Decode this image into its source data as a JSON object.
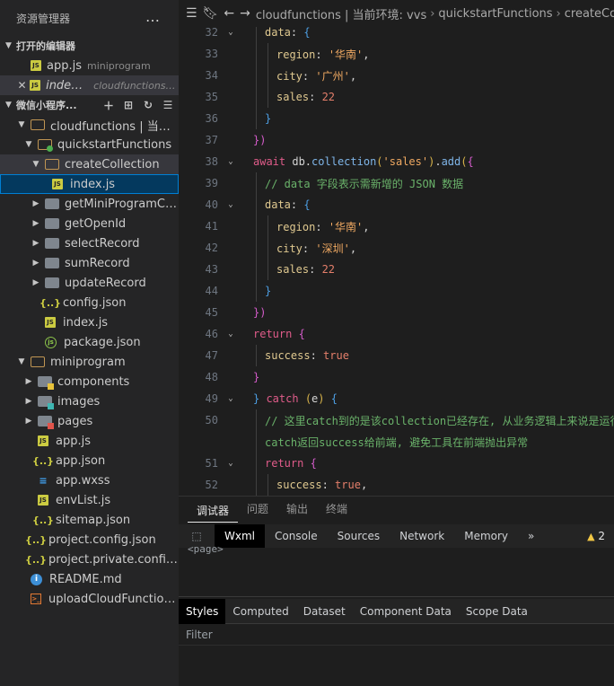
{
  "sidebar": {
    "title": "资源管理器",
    "more": "…",
    "open_editors": {
      "title": "打开的编辑器",
      "items": [
        {
          "name": "app.js",
          "desc": "miniprogram"
        },
        {
          "name": "index.js",
          "desc": "cloudfunctions\\q..."
        }
      ]
    },
    "project": {
      "title": "微信小程序..."
    },
    "tree": [
      {
        "label": "cloudfunctions | 当前..."
      },
      {
        "label": "quickstartFunctions"
      },
      {
        "label": "createCollection"
      },
      {
        "label": "index.js"
      },
      {
        "label": "getMiniProgramCode"
      },
      {
        "label": "getOpenId"
      },
      {
        "label": "selectRecord"
      },
      {
        "label": "sumRecord"
      },
      {
        "label": "updateRecord"
      },
      {
        "label": "config.json"
      },
      {
        "label": "index.js"
      },
      {
        "label": "package.json"
      },
      {
        "label": "miniprogram"
      },
      {
        "label": "components"
      },
      {
        "label": "images"
      },
      {
        "label": "pages"
      },
      {
        "label": "app.js"
      },
      {
        "label": "app.json"
      },
      {
        "label": "app.wxss"
      },
      {
        "label": "envList.js"
      },
      {
        "label": "sitemap.json"
      },
      {
        "label": "project.config.json"
      },
      {
        "label": "project.private.config.js..."
      },
      {
        "label": "README.md"
      },
      {
        "label": "uploadCloudFunction...."
      }
    ]
  },
  "editor": {
    "breadcrumb": [
      "cloudfunctions | 当前环境: vvs",
      "quickstartFunctions",
      "createCo"
    ]
  },
  "code": {
    "lines": [
      {
        "n": "32",
        "tokens": [
          [
            "key",
            "data"
          ],
          [
            "p",
            ": "
          ],
          [
            "brace2",
            "{"
          ]
        ]
      },
      {
        "n": "33",
        "tokens": [
          [
            "key",
            "region"
          ],
          [
            "p",
            ": "
          ],
          [
            "strv",
            "'华南'"
          ],
          [
            "p",
            ","
          ]
        ]
      },
      {
        "n": "34",
        "tokens": [
          [
            "key",
            "city"
          ],
          [
            "p",
            ": "
          ],
          [
            "strv",
            "'广州'"
          ],
          [
            "p",
            ","
          ]
        ]
      },
      {
        "n": "35",
        "tokens": [
          [
            "key",
            "sales"
          ],
          [
            "p",
            ": "
          ],
          [
            "num-lit",
            "22"
          ]
        ]
      },
      {
        "n": "36",
        "tokens": [
          [
            "brace2",
            "}"
          ]
        ]
      },
      {
        "n": "37",
        "tokens": [
          [
            "brace",
            "})"
          ]
        ]
      },
      {
        "n": "38",
        "tokens": [
          [
            "kw",
            "await "
          ],
          [
            "p",
            "db."
          ],
          [
            "fn",
            "collection"
          ],
          [
            "paren",
            "("
          ],
          [
            "strv",
            "'sales'"
          ],
          [
            "paren",
            ")"
          ],
          [
            "p",
            "."
          ],
          [
            "fn",
            "add"
          ],
          [
            "paren",
            "("
          ],
          [
            "brace",
            "{"
          ]
        ]
      },
      {
        "n": "39",
        "tokens": [
          [
            "cm",
            "// data 字段表示需新增的 JSON 数据"
          ]
        ]
      },
      {
        "n": "40",
        "tokens": [
          [
            "key",
            "data"
          ],
          [
            "p",
            ": "
          ],
          [
            "brace2",
            "{"
          ]
        ]
      },
      {
        "n": "41",
        "tokens": [
          [
            "key",
            "region"
          ],
          [
            "p",
            ": "
          ],
          [
            "strv",
            "'华南'"
          ],
          [
            "p",
            ","
          ]
        ]
      },
      {
        "n": "42",
        "tokens": [
          [
            "key",
            "city"
          ],
          [
            "p",
            ": "
          ],
          [
            "strv",
            "'深圳'"
          ],
          [
            "p",
            ","
          ]
        ]
      },
      {
        "n": "43",
        "tokens": [
          [
            "key",
            "sales"
          ],
          [
            "p",
            ": "
          ],
          [
            "num-lit",
            "22"
          ]
        ]
      },
      {
        "n": "44",
        "tokens": [
          [
            "brace2",
            "}"
          ]
        ]
      },
      {
        "n": "45",
        "tokens": [
          [
            "brace",
            "})"
          ]
        ]
      },
      {
        "n": "46",
        "tokens": [
          [
            "kw",
            "return "
          ],
          [
            "brace",
            "{"
          ]
        ]
      },
      {
        "n": "47",
        "tokens": [
          [
            "key",
            "success"
          ],
          [
            "p",
            ": "
          ],
          [
            "bool",
            "true"
          ]
        ]
      },
      {
        "n": "48",
        "tokens": [
          [
            "brace",
            "}"
          ]
        ]
      },
      {
        "n": "49",
        "tokens": [
          [
            "brace2",
            "} "
          ],
          [
            "kw",
            "catch "
          ],
          [
            "paren",
            "("
          ],
          [
            "p",
            "e"
          ],
          [
            "paren",
            ") "
          ],
          [
            "brace2",
            "{"
          ]
        ]
      },
      {
        "n": "50",
        "tokens": [
          [
            "cm",
            "// 这里catch到的是该collection已经存在, 从业务逻辑上来说是运行成"
          ]
        ]
      },
      {
        "n": "",
        "tokens": [
          [
            "cm",
            "catch返回success给前端, 避免工具在前端抛出异常"
          ]
        ]
      },
      {
        "n": "51",
        "tokens": [
          [
            "kw",
            "return "
          ],
          [
            "brace",
            "{"
          ]
        ]
      },
      {
        "n": "52",
        "tokens": [
          [
            "key",
            "success"
          ],
          [
            "p",
            ": "
          ],
          [
            "bool",
            "true"
          ],
          [
            "p",
            ","
          ]
        ]
      }
    ]
  },
  "panel": {
    "tabs": [
      "调试器",
      "问题",
      "输出",
      "终端"
    ],
    "devtools_tabs": [
      "Wxml",
      "Console",
      "Sources",
      "Network",
      "Memory"
    ],
    "more": "»",
    "warnings": "2",
    "dom_node": "<page>",
    "style_tabs": [
      "Styles",
      "Computed",
      "Dataset",
      "Component Data",
      "Scope Data"
    ],
    "filter": "Filter"
  }
}
